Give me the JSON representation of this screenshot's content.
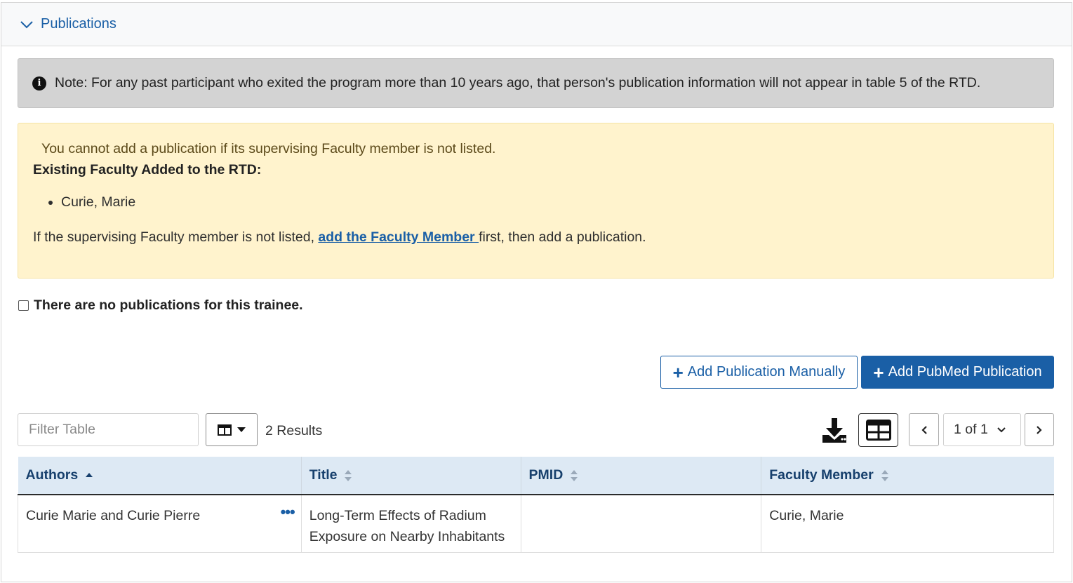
{
  "panel": {
    "title": "Publications",
    "icon": "chevron-down-icon"
  },
  "note": {
    "icon": "info-circle-icon",
    "text": "Note: For any past participant who exited the program more than 10 years ago, that person's publication information will not appear in table 5 of the RTD."
  },
  "warning": {
    "line1": "You cannot add a publication if its supervising Faculty member is not listed.",
    "heading": "Existing Faculty Added to the RTD:",
    "faculty": [
      "Curie, Marie"
    ],
    "before_link": "If the supervising Faculty member is not listed, ",
    "link_text": "add the Faculty Member ",
    "after_link": "first, then add a publication."
  },
  "no_pubs_checkbox": {
    "label": "There are no publications for this trainee.",
    "checked": false
  },
  "buttons": {
    "add_manual": "Add Publication Manually",
    "add_pubmed": "Add PubMed Publication"
  },
  "toolbar": {
    "filter_placeholder": "Filter Table",
    "results": "2 Results",
    "page": "1 of 1"
  },
  "table": {
    "columns": [
      "Authors",
      "Title",
      "PMID",
      "Faculty Member"
    ],
    "sorted_column": "Authors",
    "rows": [
      {
        "authors": "Curie Marie and Curie Pierre",
        "title_line1": "Long-Term Effects of Radium",
        "title_line2": "Exposure on Nearby Inhabitants",
        "pmid": "",
        "faculty": "Curie, Marie"
      }
    ]
  },
  "colors": {
    "accent": "#1a5fa6",
    "note_bg": "#d3d3d3",
    "warning_bg": "#fff3cd",
    "table_header_bg": "#dde9f4"
  }
}
